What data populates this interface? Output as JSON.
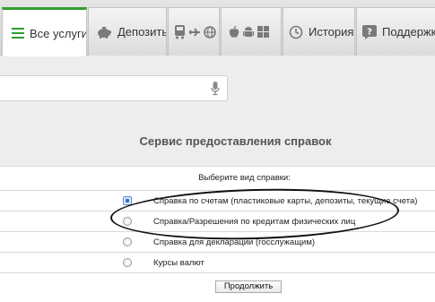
{
  "tabs": [
    {
      "label": "Все услуги",
      "icon": "list-icon",
      "active": true
    },
    {
      "label": "Депозиты",
      "icon": "piggy-bank-icon",
      "active": false
    },
    {
      "label": "",
      "icon": "transport-icons",
      "active": false
    },
    {
      "label": "",
      "icon": "platform-icons",
      "active": false
    },
    {
      "label": "История",
      "icon": "history-icon",
      "active": false
    },
    {
      "label": "Поддержка",
      "icon": "help-icon",
      "active": false
    }
  ],
  "search": {
    "placeholder": ""
  },
  "page_title": "Сервис предоставления справок",
  "form": {
    "header": "Выберите вид справки:",
    "options": [
      {
        "label": "Справка по счетам (пластиковые карты, депозиты, текущие счета)",
        "checked": true
      },
      {
        "label": "Справка/Разрешения по кредитам физических лиц",
        "checked": false
      },
      {
        "label": "Справка для декларации (госслужащим)",
        "checked": false
      },
      {
        "label": "Курсы валют",
        "checked": false
      }
    ],
    "submit_label": "Продолжить"
  },
  "colors": {
    "accent": "#2f9e2f",
    "background": "#ededed"
  }
}
